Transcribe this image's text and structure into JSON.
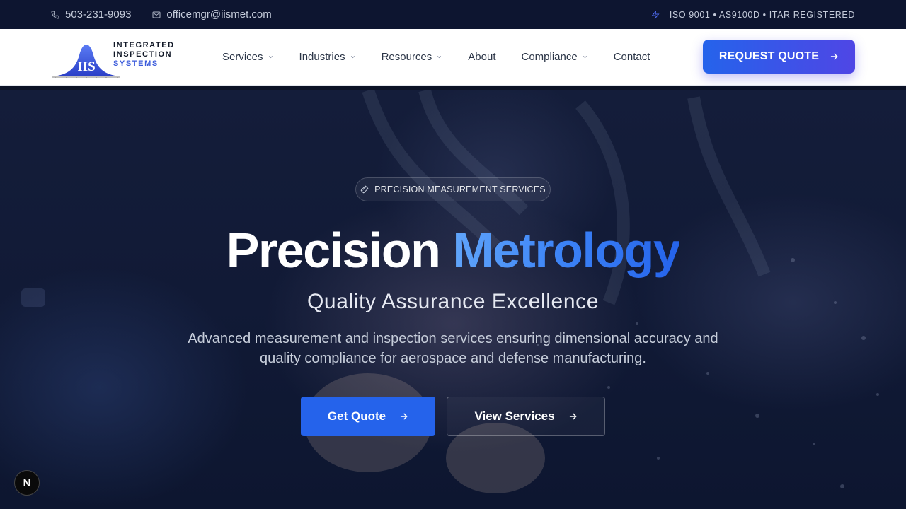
{
  "topbar": {
    "phone": "503-231-9093",
    "email": "officemgr@iismet.com",
    "certifications": "ISO 9001 • AS9100D • ITAR REGISTERED",
    "icons": {
      "phone": "phone-icon",
      "email": "mail-icon",
      "cert": "bolt-icon"
    }
  },
  "logo": {
    "mark": "IIS",
    "line1": "INTEGRATED",
    "line2": "INSPECTION",
    "line3": "SYSTEMS"
  },
  "nav": {
    "items": [
      {
        "label": "Services",
        "dropdown": true
      },
      {
        "label": "Industries",
        "dropdown": true
      },
      {
        "label": "Resources",
        "dropdown": true
      },
      {
        "label": "About",
        "dropdown": false
      },
      {
        "label": "Compliance",
        "dropdown": true
      },
      {
        "label": "Contact",
        "dropdown": false
      }
    ],
    "cta_label": "REQUEST QUOTE"
  },
  "hero": {
    "badge": "PRECISION MEASUREMENT SERVICES",
    "headline_main": "Precision",
    "headline_accent": "Metrology",
    "subheadline": "Quality Assurance Excellence",
    "description": "Advanced measurement and inspection services ensuring dimensional accuracy and quality compliance for aerospace and defense manufacturing.",
    "primary_cta": "Get Quote",
    "secondary_cta": "View Services"
  },
  "dev_badge": "N",
  "colors": {
    "accent": "#2563eb",
    "accent_secondary": "#4f46e5",
    "topbar_bg": "#0d1530",
    "hero_bg": "#111a36"
  }
}
